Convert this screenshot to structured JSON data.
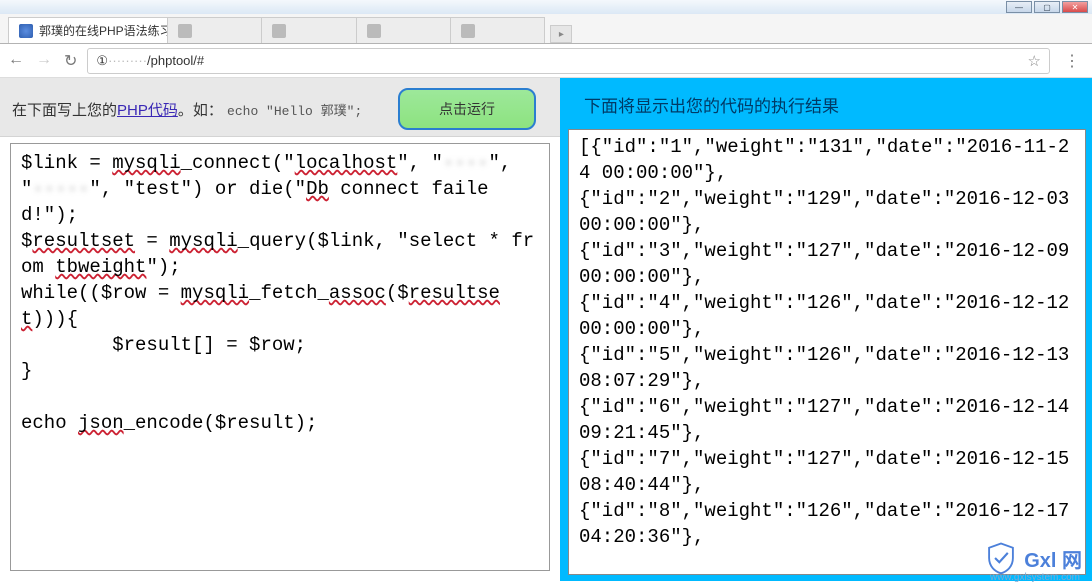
{
  "window": {
    "buttons": {
      "min": "—",
      "max": "▢",
      "close": "✕"
    }
  },
  "tabs": {
    "items": [
      {
        "title": "郭璞的在线PHP语法练习",
        "active": true
      },
      {
        "title": "",
        "active": false
      },
      {
        "title": "",
        "active": false
      },
      {
        "title": "",
        "active": false
      },
      {
        "title": "",
        "active": false
      }
    ],
    "close_glyph": "×"
  },
  "urlbar": {
    "back": "←",
    "fwd": "→",
    "reload": "↻",
    "url_prefix": "① ",
    "url_host_hidden": "·········",
    "url_path": "/phptool/#",
    "star": "☆",
    "menu": "⋮"
  },
  "left": {
    "prompt_prefix": "在下面写上您的",
    "prompt_link": "PHP代码",
    "prompt_suffix": "。如：",
    "prompt_sample": "echo \"Hello 郭璞\";",
    "run_label": "点击运行",
    "code": "$link = mysqli_connect(\"localhost\", \"····\", \"·····\", \"test\") or die(\"Db connect failed!\");\n$resultset = mysqli_query($link, \"select * from tbweight\");\nwhile(($row = mysqli_fetch_assoc($resultset))){\n        $result[] = $row;\n}\n\necho json_encode($result);"
  },
  "right": {
    "head": "下面将显示出您的代码的执行结果",
    "output": "[{\"id\":\"1\",\"weight\":\"131\",\"date\":\"2016-11-24 00:00:00\"},\n{\"id\":\"2\",\"weight\":\"129\",\"date\":\"2016-12-03 00:00:00\"},\n{\"id\":\"3\",\"weight\":\"127\",\"date\":\"2016-12-09 00:00:00\"},\n{\"id\":\"4\",\"weight\":\"126\",\"date\":\"2016-12-12 00:00:00\"},\n{\"id\":\"5\",\"weight\":\"126\",\"date\":\"2016-12-13 08:07:29\"},\n{\"id\":\"6\",\"weight\":\"127\",\"date\":\"2016-12-14 09:21:45\"},\n{\"id\":\"7\",\"weight\":\"127\",\"date\":\"2016-12-15 08:40:44\"},\n{\"id\":\"8\",\"weight\":\"126\",\"date\":\"2016-12-17 04:20:36\"},"
  },
  "watermark": {
    "text": "Gxl 网",
    "sub": "www.gxlsystem.com"
  }
}
